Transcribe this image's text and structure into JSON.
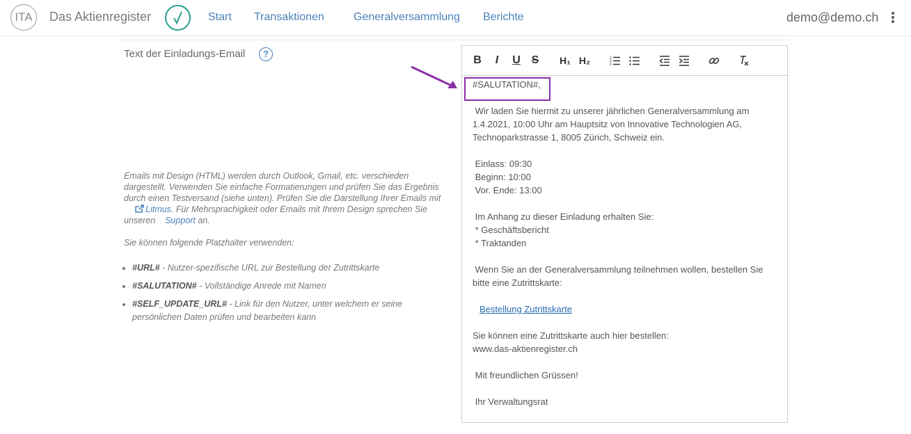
{
  "header": {
    "logo_text": "ITA",
    "app_title": "Das Aktienregister",
    "nav": [
      "Start",
      "Transaktionen",
      "Generalversammlung",
      "Berichte"
    ],
    "user_email": "demo@demo.ch"
  },
  "left": {
    "field_label": "Text der Einladungs-Email",
    "help_glyph": "?",
    "note_part1": "Emails mit Design (HTML) werden durch Outlook, Gmail, etc. verschieden dargestellt. Verwenden Sie einfache Formatierungen und prüfen Sie das Ergebnis durch einen Testversand (siehe unten). Prüfen Sie die Darstellung Ihrer Emails mit",
    "litmus_link": "Litmus",
    "note_part2": ". Für Mehrsprachigkeit oder Emails mit Ihrem Design sprechen Sie unseren",
    "support_link": "Support",
    "note_part3": " an.",
    "placeholders_intro": "Sie können folgende Platzhalter verwenden:",
    "placeholders": [
      {
        "key": "#URL#",
        "desc": " - Nutzer-spezifische URL zur Bestellung der Zutrittskarte"
      },
      {
        "key": "#SALUTATION#",
        "desc": " - Vollständige Anrede mit Namen"
      },
      {
        "key": "#SELF_UPDATE_URL#",
        "desc": " - Link für den Nutzer, unter welchem er seine persönlichen Daten prüfen und bearbeiten kann"
      }
    ]
  },
  "editor": {
    "toolbar": {
      "bold": "B",
      "italic": "I",
      "underline": "U",
      "strike": "S",
      "h1": "H₁",
      "h2": "H₂"
    },
    "content": {
      "salutation": "#SALUTATION#,",
      "invite": " Wir laden Sie hiermit zu unserer jährlichen Generalversammlung am 1.4.2021, 10:00 Uhr am Hauptsitz von Innovative Technologien AG, Technoparkstrasse 1, 8005 Zürich, Schweiz ein.",
      "einlass": " Einlass: 09:30",
      "beginn": " Beginn: 10:00",
      "ende": " Vor. Ende: 13:00",
      "anhang": " Im Anhang zu dieser Einladung erhalten Sie:",
      "item1": " * Geschäftsbericht",
      "item2": " * Traktanden",
      "teilnahme": " Wenn Sie an der Generalversammlung teilnehmen wollen, bestellen Sie bitte eine Zutrittskarte:",
      "order_link": "Bestellung Zutrittskarte",
      "alt_order": "Sie können eine Zutrittskarte auch hier bestellen:",
      "website": "www.das-aktienregister.ch",
      "greeting": " Mit freundlichen Grüssen!",
      "signature": " Ihr Verwaltungsrat"
    }
  },
  "colors": {
    "link": "#4a82b9",
    "check": "#29a08d",
    "annotation": "#8b2fa8"
  }
}
